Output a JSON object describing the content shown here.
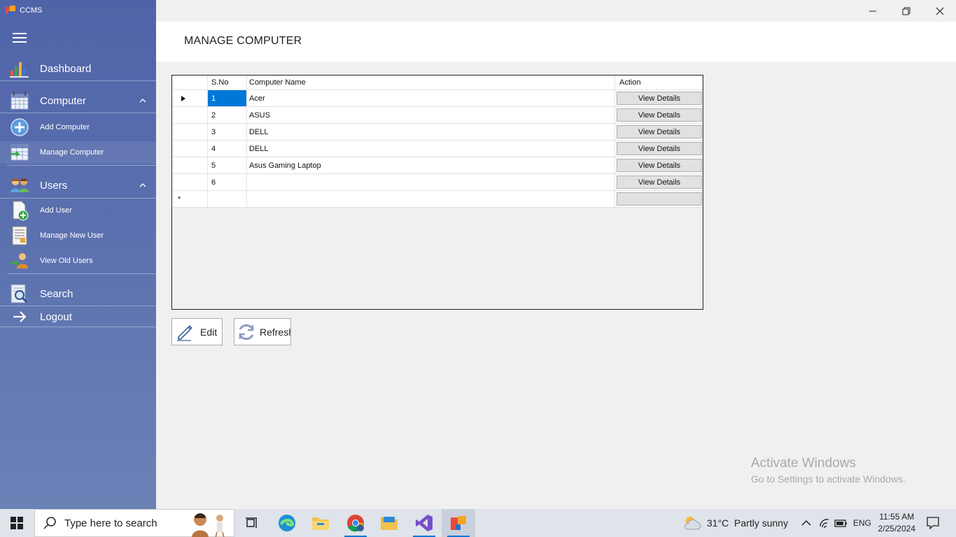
{
  "app": {
    "title": "CCMS"
  },
  "sidebar": {
    "dashboard": "Dashboard",
    "computer": {
      "label": "Computer",
      "items": [
        "Add Computer",
        "Manage Computer"
      ]
    },
    "users": {
      "label": "Users",
      "items": [
        "Add User",
        "Manage New User",
        "View Old Users"
      ]
    },
    "search": "Search",
    "logout": "Logout"
  },
  "page": {
    "title": "MANAGE COMPUTER"
  },
  "grid": {
    "columns": [
      "S.No",
      "Computer Name",
      "Action"
    ],
    "rows": [
      {
        "sno": "1",
        "name": "Acer",
        "action": "View Details"
      },
      {
        "sno": "2",
        "name": "ASUS",
        "action": "View Details"
      },
      {
        "sno": "3",
        "name": "DELL",
        "action": "View Details"
      },
      {
        "sno": "4",
        "name": "DELL",
        "action": "View Details"
      },
      {
        "sno": "5",
        "name": "Asus Gaming Laptop",
        "action": "View Details"
      },
      {
        "sno": "6",
        "name": "",
        "action": "View Details"
      }
    ],
    "new_row_marker": "*"
  },
  "buttons": {
    "edit": "Edit",
    "refresh": "Refresh"
  },
  "watermark": {
    "line1": "Activate Windows",
    "line2": "Go to Settings to activate Windows."
  },
  "taskbar": {
    "search_placeholder": "Type here to search",
    "weather": "31°C  Partly sunny",
    "language": "ENG",
    "time": "11:55 AM",
    "date": "2/25/2024"
  },
  "colors": {
    "sidebar": "#5a6fae",
    "selection": "#0078d7",
    "background": "#f0f0f0"
  }
}
